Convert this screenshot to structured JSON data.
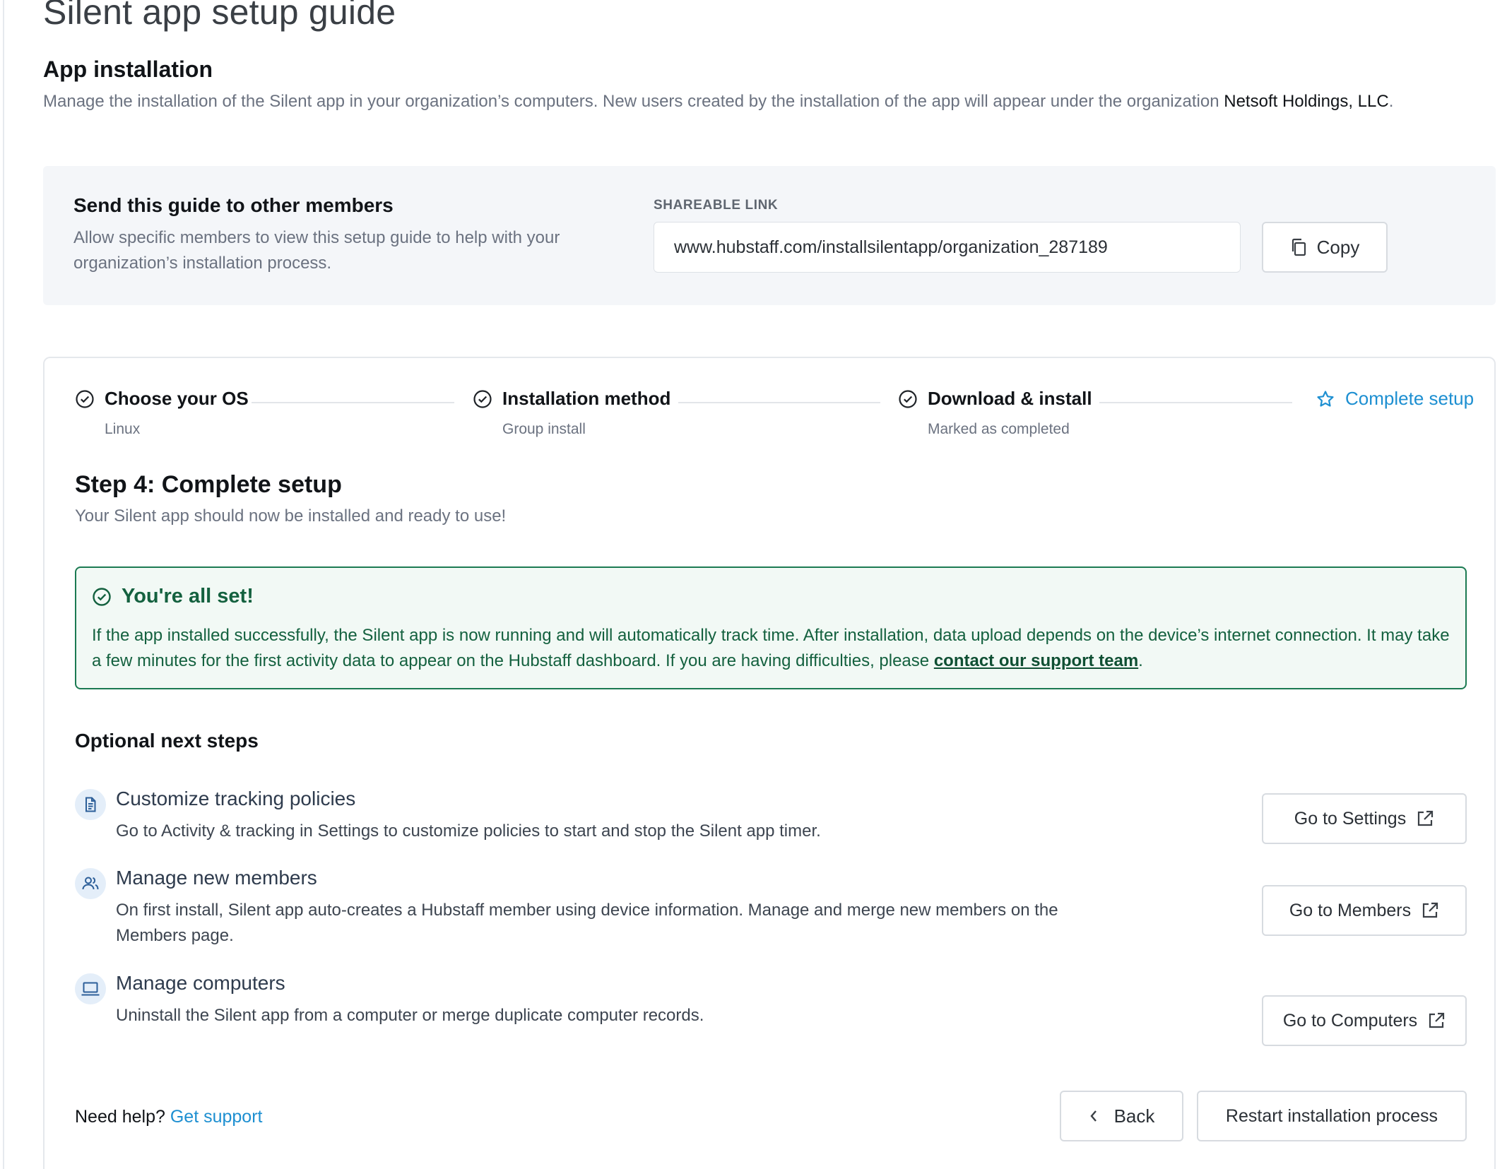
{
  "page": {
    "title": "Silent app setup guide"
  },
  "app_installation": {
    "title": "App installation",
    "description": "Manage the installation of the Silent app in your organization’s computers. New users created by the installation of the app will appear under the organization",
    "organization": "Netsoft Holdings, LLC",
    "description_end": "."
  },
  "share": {
    "title": "Send this guide to other members",
    "description": "Allow specific members to view this setup guide to help with your organization’s installation process.",
    "link_label": "SHAREABLE LINK",
    "link_value": "www.hubstaff.com/installsilentapp/organization_287189",
    "copy_label": "Copy"
  },
  "stepper": {
    "steps": [
      {
        "label": "Choose your OS",
        "sub": "Linux",
        "status": "done"
      },
      {
        "label": "Installation method",
        "sub": "Group install",
        "status": "done"
      },
      {
        "label": "Download & install",
        "sub": "Marked as completed",
        "status": "done"
      },
      {
        "label": "Complete setup",
        "sub": "",
        "status": "active"
      }
    ]
  },
  "step4": {
    "heading": "Step 4: Complete setup",
    "description": "Your Silent app should now be installed and ready to use!"
  },
  "success": {
    "title": "You're all set!",
    "text": "If the app installed successfully, the Silent app is now running and will automatically track time. After installation, data upload depends on the device’s internet connection. It may take a few minutes for the first activity data to appear on the Hubstaff dashboard. If you are having difficulties, please",
    "link": "contact our support team",
    "text_end": "."
  },
  "optional": {
    "heading": "Optional next steps",
    "items": [
      {
        "icon": "document-icon",
        "title": "Customize tracking policies",
        "description": "Go to Activity & tracking in Settings to customize policies to start and stop the Silent app timer.",
        "button": "Go to Settings"
      },
      {
        "icon": "members-icon",
        "title": "Manage new members",
        "description": "On first install, Silent app auto-creates a Hubstaff member using device information. Manage and merge new members on the Members page.",
        "button": "Go to Members"
      },
      {
        "icon": "laptop-icon",
        "title": "Manage computers",
        "description": "Uninstall the Silent app from a computer or merge duplicate computer records.",
        "button": "Go to Computers"
      }
    ]
  },
  "footer": {
    "help_text": "Need help?",
    "help_link": "Get support",
    "back_label": "Back",
    "restart_label": "Restart installation process"
  },
  "colors": {
    "accent": "#1d8fd1",
    "success": "#1b7a52",
    "panel": "#f4f6f9"
  }
}
